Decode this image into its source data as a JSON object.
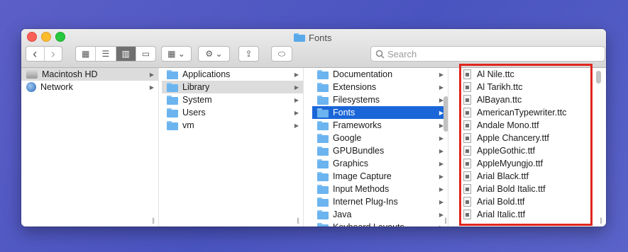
{
  "window": {
    "title": "Fonts",
    "title_icon": "folder-icon"
  },
  "toolbar": {
    "back_icon": "‹",
    "forward_icon": "›",
    "view_icons": "▦",
    "view_list": "☰",
    "view_columns": "▥",
    "view_gallery": "▭",
    "group_icon": "▦ ⌄",
    "action_icon": "⚙ ⌄",
    "share_icon": "⇪",
    "tag_icon": "⬭"
  },
  "search": {
    "placeholder": "Search",
    "icon": "search-icon"
  },
  "columns": {
    "col1": [
      {
        "label": "Macintosh HD",
        "icon": "disk-icon",
        "selected": "grey",
        "arrow": true
      },
      {
        "label": "Network",
        "icon": "globe-icon",
        "selected": "",
        "arrow": true
      }
    ],
    "col2": [
      {
        "label": "Applications",
        "icon": "folder-icon",
        "selected": "",
        "arrow": true
      },
      {
        "label": "Library",
        "icon": "folder-icon",
        "selected": "grey",
        "arrow": true
      },
      {
        "label": "System",
        "icon": "folder-icon",
        "selected": "",
        "arrow": true
      },
      {
        "label": "Users",
        "icon": "folder-icon",
        "selected": "",
        "arrow": true
      },
      {
        "label": "vm",
        "icon": "folder-icon",
        "selected": "",
        "arrow": true
      }
    ],
    "col3": [
      {
        "label": "Documentation",
        "selected": "",
        "arrow": true
      },
      {
        "label": "Extensions",
        "selected": "",
        "arrow": true
      },
      {
        "label": "Filesystems",
        "selected": "",
        "arrow": true
      },
      {
        "label": "Fonts",
        "selected": "blue",
        "arrow": true
      },
      {
        "label": "Frameworks",
        "selected": "",
        "arrow": true
      },
      {
        "label": "Google",
        "selected": "",
        "arrow": true
      },
      {
        "label": "GPUBundles",
        "selected": "",
        "arrow": true
      },
      {
        "label": "Graphics",
        "selected": "",
        "arrow": true
      },
      {
        "label": "Image Capture",
        "selected": "",
        "arrow": true
      },
      {
        "label": "Input Methods",
        "selected": "",
        "arrow": true
      },
      {
        "label": "Internet Plug-Ins",
        "selected": "",
        "arrow": true
      },
      {
        "label": "Java",
        "selected": "",
        "arrow": true
      },
      {
        "label": "Keyboard Layouts",
        "selected": "",
        "arrow": true
      }
    ],
    "col4": [
      "Al Nile.ttc",
      "Al Tarikh.ttc",
      "AlBayan.ttc",
      "AmericanTypewriter.ttc",
      "Andale Mono.ttf",
      "Apple Chancery.ttf",
      "AppleGothic.ttf",
      "AppleMyungjo.ttf",
      "Arial Black.ttf",
      "Arial Bold Italic.ttf",
      "Arial Bold.ttf",
      "Arial Italic.ttf"
    ]
  },
  "colors": {
    "selection_blue": "#1a66d8",
    "highlight_red": "#e0261e",
    "background": "#5b5fc7"
  }
}
